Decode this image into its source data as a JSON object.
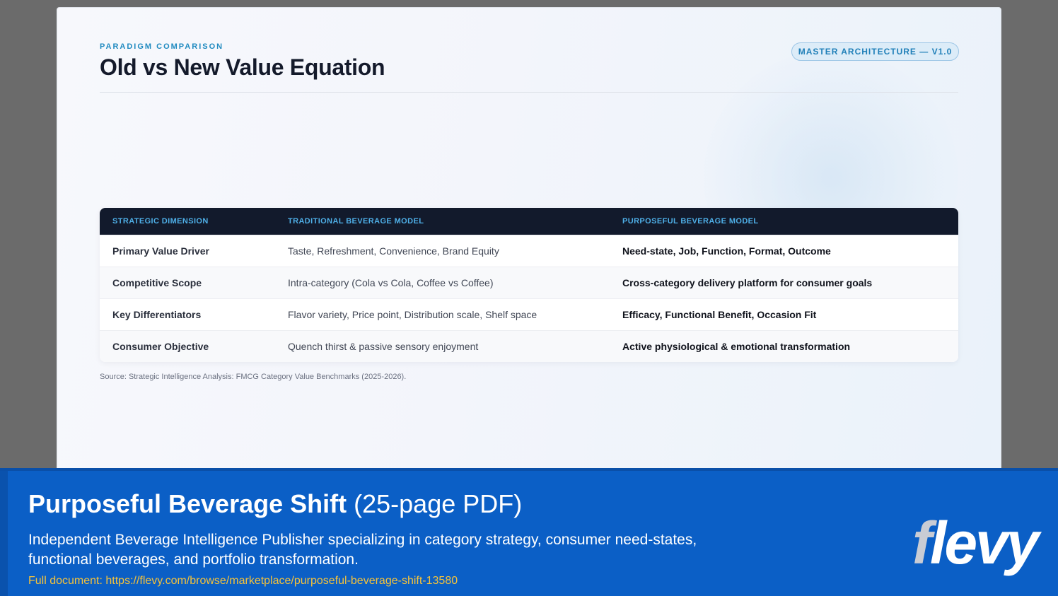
{
  "slide": {
    "eyebrow": "PARADIGM COMPARISON",
    "title": "Old vs New Value Equation",
    "badge": "MASTER ARCHITECTURE — V1.0",
    "table": {
      "headers": [
        "STRATEGIC DIMENSION",
        "TRADITIONAL BEVERAGE MODEL",
        "PURPOSEFUL BEVERAGE MODEL"
      ],
      "rows": [
        [
          "Primary Value Driver",
          "Taste, Refreshment, Convenience, Brand Equity",
          "Need-state, Job, Function, Format, Outcome"
        ],
        [
          "Competitive Scope",
          "Intra-category (Cola vs Cola, Coffee vs Coffee)",
          "Cross-category delivery platform for consumer goals"
        ],
        [
          "Key Differentiators",
          "Flavor variety, Price point, Distribution scale, Shelf space",
          "Efficacy, Functional Benefit, Occasion Fit"
        ],
        [
          "Consumer Objective",
          "Quench thirst & passive sensory enjoyment",
          "Active physiological & emotional transformation"
        ]
      ]
    },
    "source": "Source: Strategic Intelligence Analysis: FMCG Category Value Benchmarks (2025-2026)."
  },
  "banner": {
    "title": "Purposeful Beverage Shift",
    "pages": "(25-page PDF)",
    "description": "Independent Beverage Intelligence Publisher specializing in category strategy, consumer need-states, functional beverages, and portfolio transformation.",
    "link": "Full document: https://flevy.com/browse/marketplace/purposeful-beverage-shift-13580",
    "logo_f": "f",
    "logo_rest": "levy"
  }
}
